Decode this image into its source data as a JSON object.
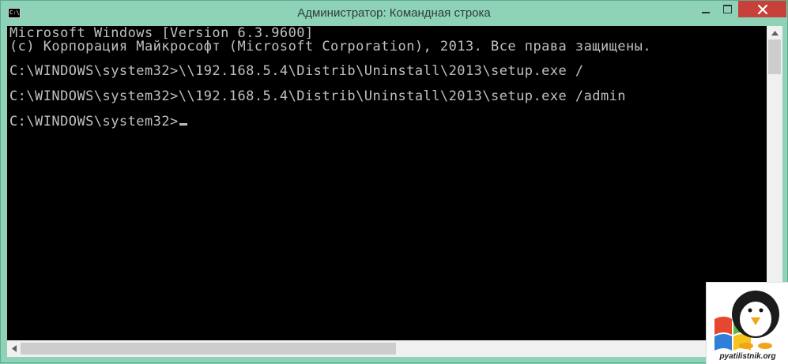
{
  "window": {
    "title": "Администратор: Командная строка",
    "icon_label": "C:\\."
  },
  "console": {
    "lines": [
      "Microsoft Windows [Version 6.3.9600]",
      "(c) Корпорация Майкрософт (Microsoft Corporation), 2013. Все права защищены.",
      "C:\\WINDOWS\\system32>\\\\192.168.5.4\\Distrib\\Uninstall\\2013\\setup.exe /",
      "C:\\WINDOWS\\system32>\\\\192.168.5.4\\Distrib\\Uninstall\\2013\\setup.exe /admin",
      "C:\\WINDOWS\\system32>"
    ]
  },
  "watermark": {
    "text": "pyatilistnik.org"
  },
  "colors": {
    "frame": "#8ed3b8",
    "close_button": "#c7403a",
    "console_bg": "#000000",
    "console_text": "#c0c0c0"
  },
  "icons": {
    "app": "cmd-icon",
    "minimize": "minimize-icon",
    "maximize": "maximize-icon",
    "close": "close-icon"
  }
}
